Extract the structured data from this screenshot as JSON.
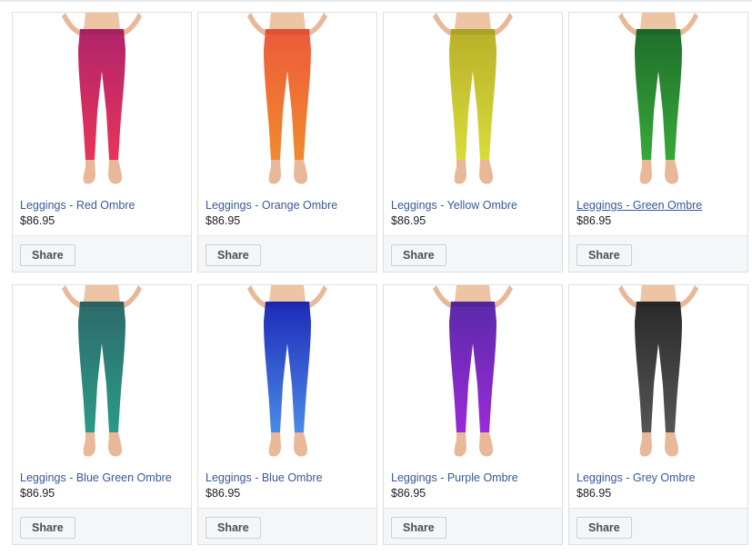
{
  "products": [
    {
      "title": "Leggings - Red Ombre",
      "price": "$86.95",
      "share_label": "Share",
      "color_top": "#b0246a",
      "color_bottom": "#e8345a",
      "hovered": false
    },
    {
      "title": "Leggings - Orange Ombre",
      "price": "$86.95",
      "share_label": "Share",
      "color_top": "#ee5a3a",
      "color_bottom": "#f08a2e",
      "hovered": false
    },
    {
      "title": "Leggings - Yellow Ombre",
      "price": "$86.95",
      "share_label": "Share",
      "color_top": "#b8b02a",
      "color_bottom": "#d8dc3a",
      "hovered": false
    },
    {
      "title": "Leggings - Green Ombre",
      "price": "$86.95",
      "share_label": "Share",
      "color_top": "#1e6e2a",
      "color_bottom": "#38a83a",
      "hovered": true
    },
    {
      "title": "Leggings - Blue Green Ombre",
      "price": "$86.95",
      "share_label": "Share",
      "color_top": "#2e6a6a",
      "color_bottom": "#2a9a88",
      "hovered": false
    },
    {
      "title": "Leggings - Blue Ombre",
      "price": "$86.95",
      "share_label": "Share",
      "color_top": "#1e2ab8",
      "color_bottom": "#4a8ae8",
      "hovered": false
    },
    {
      "title": "Leggings - Purple Ombre",
      "price": "$86.95",
      "share_label": "Share",
      "color_top": "#5a2aa8",
      "color_bottom": "#9a2ad8",
      "hovered": false
    },
    {
      "title": "Leggings - Grey Ombre",
      "price": "$86.95",
      "share_label": "Share",
      "color_top": "#2a2a2a",
      "color_bottom": "#555555",
      "hovered": false
    }
  ]
}
